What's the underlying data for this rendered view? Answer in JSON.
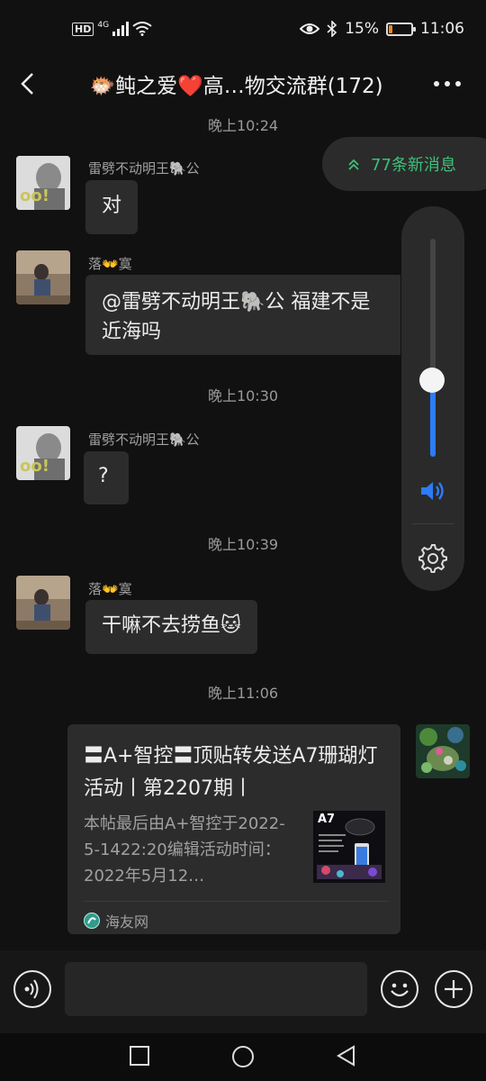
{
  "status_bar": {
    "hd": "HD",
    "network": "4G",
    "battery_percent": "15%",
    "battery_level": 0.15,
    "time": "11:06"
  },
  "header": {
    "title": "🐡鲀之爱❤️高…物交流群(172)"
  },
  "new_messages": {
    "label": "77条新消息"
  },
  "timestamps": [
    "晚上10:24",
    "晚上10:30",
    "晚上10:39",
    "晚上11:06"
  ],
  "messages": [
    {
      "name": "雷劈不动明王🐘公",
      "text": "对"
    },
    {
      "name": "落👐寞",
      "text": "@雷劈不动明王🐘公  福建不是近海吗"
    },
    {
      "name": "雷劈不动明王🐘公",
      "text": "?"
    },
    {
      "name": "落👐寞",
      "text": "干嘛不去捞鱼🐱"
    }
  ],
  "link_card": {
    "title": "〓A+智控〓顶贴转发送A7珊瑚灯活动丨第2207期丨",
    "desc": "本帖最后由A+智控于2022-5-1422:20编辑活动时间：2022年5月12…",
    "source": "海友网",
    "thumb_label": "A7"
  },
  "volume": {
    "level": 0.35
  },
  "input": {
    "placeholder": ""
  },
  "colors": {
    "accent_green": "#3ec07a",
    "volume_blue": "#2d7cf6",
    "battery_orange": "#f08a24"
  }
}
